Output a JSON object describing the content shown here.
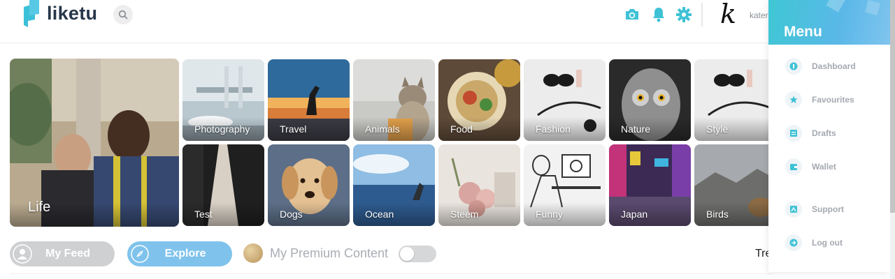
{
  "header": {
    "logo_text": "liketu",
    "username": "kater"
  },
  "categories": [
    {
      "id": "life",
      "label": "Life"
    },
    {
      "id": "photography",
      "label": "Photography"
    },
    {
      "id": "travel",
      "label": "Travel"
    },
    {
      "id": "animals",
      "label": "Animals"
    },
    {
      "id": "food",
      "label": "Food"
    },
    {
      "id": "fashion",
      "label": "Fashion"
    },
    {
      "id": "nature",
      "label": "Nature"
    },
    {
      "id": "style",
      "label": "Style"
    },
    {
      "id": "test",
      "label": "Test"
    },
    {
      "id": "dogs",
      "label": "Dogs"
    },
    {
      "id": "ocean",
      "label": "Ocean"
    },
    {
      "id": "steem",
      "label": "Steem"
    },
    {
      "id": "funny",
      "label": "Funny"
    },
    {
      "id": "japan",
      "label": "Japan"
    },
    {
      "id": "birds",
      "label": "Birds"
    }
  ],
  "feed_bar": {
    "my_feed_label": "My Feed",
    "explore_label": "Explore",
    "premium_label": "My Premium Content",
    "premium_toggle_on": false,
    "trending_label": "Tre"
  },
  "menu": {
    "title": "Menu",
    "items": [
      {
        "label": "Dashboard",
        "icon": "dashboard-icon"
      },
      {
        "label": "Favourites",
        "icon": "star-icon"
      },
      {
        "label": "Drafts",
        "icon": "drafts-icon"
      },
      {
        "label": "Wallet",
        "icon": "wallet-icon"
      },
      {
        "label": "Support",
        "icon": "support-icon"
      },
      {
        "label": "Log out",
        "icon": "logout-icon"
      }
    ]
  },
  "colors": {
    "accent": "#3fc7d4",
    "explore_pill": "#7fc3ec",
    "my_feed_pill": "#cfd0d2",
    "menu_text": "#a4a9b0"
  }
}
